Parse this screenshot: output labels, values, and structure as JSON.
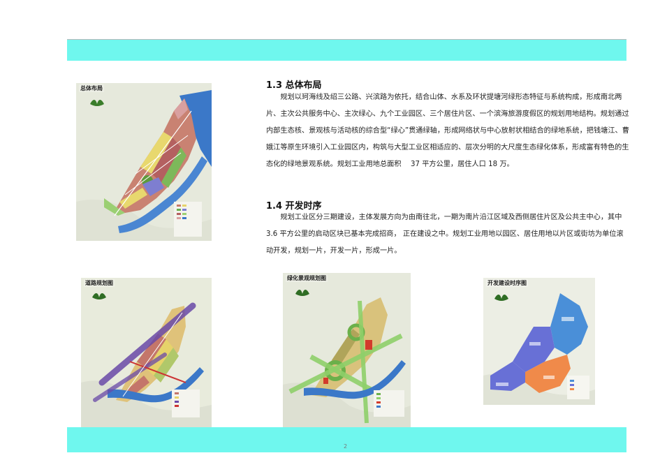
{
  "page": {
    "number": "2"
  },
  "sections": [
    {
      "heading": "1.3 总体布局",
      "paragraph": "规划以珂海线及绍三公路、兴滨路为依托，结合山体、水系及环状提塘河绿形态特征与系统构成，形成南北两片、主次公共服务中心、主次绿心、九个工业园区、三个居住片区、一个滨海旅游度假区的规划用地结构。规划通过内部生态核、景观核与活动核的综合型“绿心”贯通绿轴，形成网络状与中心放射状相结合的绿地系统，把钱塘江、曹娥江等原生环境引入工业园区内，构筑与大型工业区相适应的、层次分明的大尺度生态绿化体系，形成富有特色的生态化的绿地景观系统。规划工业用地总面积　 37 平方公里，居住人口 18 万。"
    },
    {
      "heading": "1.4 开发时序",
      "paragraph": "规划工业区分三期建设，主体发展方向为由南往北，一期为南片沿江区域及西侧居住片区及公共主中心，其中 3.6 平方公里的启动区块已基本完成招商， 正在建设之中。规划工业用地以园区、居住用地以片区或街坊为单位滚动开发，规划一片，开发一片，形成一片。"
    }
  ],
  "maps": [
    {
      "title": "总体布局"
    },
    {
      "title": "道路规划图"
    },
    {
      "title": "绿化景观规划图"
    },
    {
      "title": "开发建设时序图"
    }
  ],
  "colors": {
    "band": "#6ff7ee",
    "river": "#3b78c8",
    "residential": "#c87a6a",
    "industrial": "#e6d36a",
    "green": "#6bb04a"
  }
}
